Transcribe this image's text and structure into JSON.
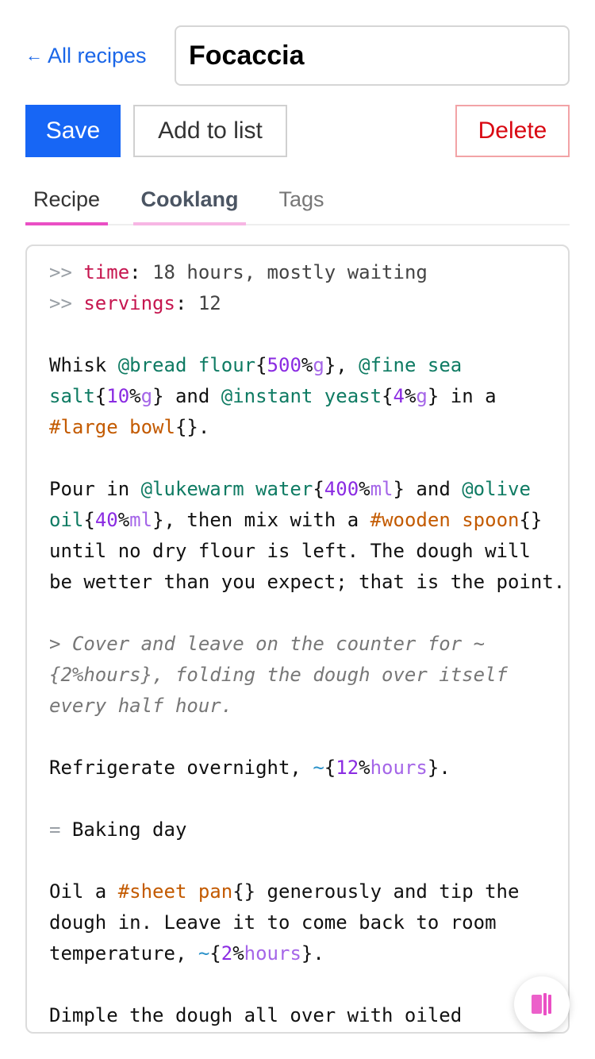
{
  "header": {
    "back_arrow": "←",
    "back_label": "All recipes",
    "title_value": "Focaccia"
  },
  "toolbar": {
    "save_label": "Save",
    "add_label": "Add to list",
    "delete_label": "Delete"
  },
  "tabs": [
    {
      "label": "Recipe"
    },
    {
      "label": "Cooklang"
    },
    {
      "label": "Tags"
    }
  ],
  "editor": {
    "meta_marker": ">>",
    "meta": [
      {
        "key": "time",
        "value": "18 hours, mostly waiting"
      },
      {
        "key": "servings",
        "value": "12"
      }
    ],
    "s1": {
      "whisk": "Whisk ",
      "ing1": "@bread flour",
      "q1": "500",
      "u1": "g",
      "ing2a": "@fine sea",
      "ing2b": "salt",
      "q2": "10",
      "u2": "g",
      "and": " and ",
      "ing3": "@instant yeast",
      "q3": "4",
      "u3": "g",
      "in_a": " in a",
      "cw1": "#large bowl"
    },
    "s2": {
      "pour": "Pour in ",
      "ing1": "@lukewarm water",
      "q1": "400",
      "u1": "ml",
      "and": " and ",
      "ing2a": "@olive",
      "ing2b": "oil",
      "q2": "40",
      "u2": "ml",
      "mix": ", then mix with a ",
      "cw1": "#wooden spoon",
      "line3": "until no dry flour is left. The dough will",
      "line4": "be wetter than you expect; that is the point."
    },
    "note": {
      "line1": "> Cover and leave on the counter for ~",
      "line2": "{2%hours}, folding the dough over itself",
      "line3": "every half hour."
    },
    "s3": {
      "text": "Refrigerate overnight, ",
      "q": "12",
      "u": "hours"
    },
    "section": {
      "marker": "=",
      "title": " Baking day"
    },
    "s4": {
      "oil_a": "Oil a ",
      "cw1": "#sheet pan",
      "rest1": " generously and tip the",
      "line2": "dough in. Leave it to come back to room",
      "line3a": "temperature, ",
      "q": "2",
      "u": "hours"
    },
    "s5": {
      "line1": "Dimple the dough all over with oiled"
    }
  },
  "fab": {
    "icon": "book-open-icon",
    "color": "#ea4fc4"
  }
}
